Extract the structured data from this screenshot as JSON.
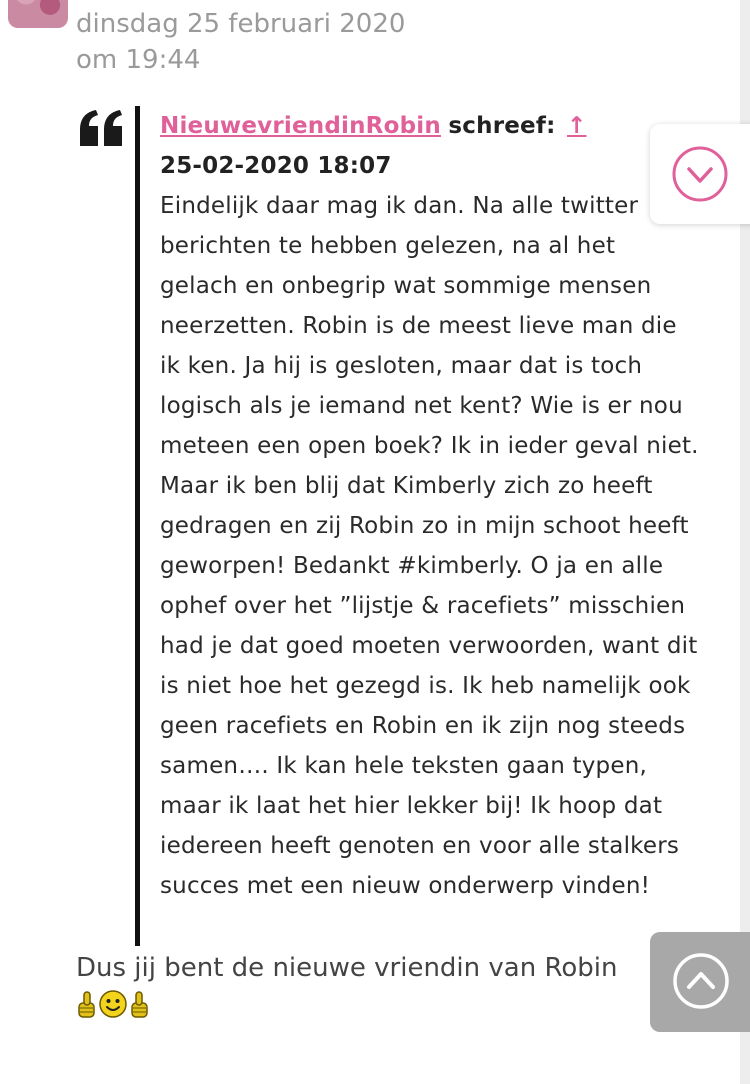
{
  "post": {
    "date_line1": "dinsdag 25 februari 2020",
    "date_line2": "om 19:44"
  },
  "quote": {
    "author": "NieuwevriendinRobin",
    "wrote_label": "schreef:",
    "up_arrow": "↑",
    "timestamp": "25-02-2020 18:07",
    "text": "Eindelijk daar mag ik dan. Na alle twitter berichten te hebben gelezen, na al het gelach en onbegrip wat sommige mensen neerzetten. Robin is de meest lieve man die ik ken. Ja hij is gesloten, maar dat is toch logisch als je iemand net kent? Wie is er nou meteen een open boek? Ik in ieder geval niet. Maar ik ben blij dat Kimberly zich zo heeft gedragen en zij Robin zo in mijn schoot heeft geworpen! Bedankt #kimberly. O ja en alle ophef over het ”lijstje & racefiets” misschien had je dat goed moeten verwoorden, want dit is niet hoe het gezegd is. Ik heb namelijk ook geen racefiets en Robin en ik zijn nog steeds samen…. Ik kan hele teksten gaan typen, maar ik laat het hier lekker bij! Ik hoop dat iedereen heeft genoten en voor alle stalkers succes met een nieuw onderwerp vinden!"
  },
  "reply": {
    "text": "Dus jij bent de nieuwe vriendin van Robin"
  },
  "emoticons": [
    "thumbs-up-icon",
    "smiley-icon",
    "thumbs-up-icon"
  ],
  "colors": {
    "accent": "#e0609a",
    "muted_text": "#9a9a9a",
    "quote_bar": "#111111",
    "scroll_up_bg": "#a8a8a8"
  },
  "buttons": {
    "scroll_down_icon": "chevron-down-icon",
    "scroll_up_icon": "chevron-up-icon"
  }
}
